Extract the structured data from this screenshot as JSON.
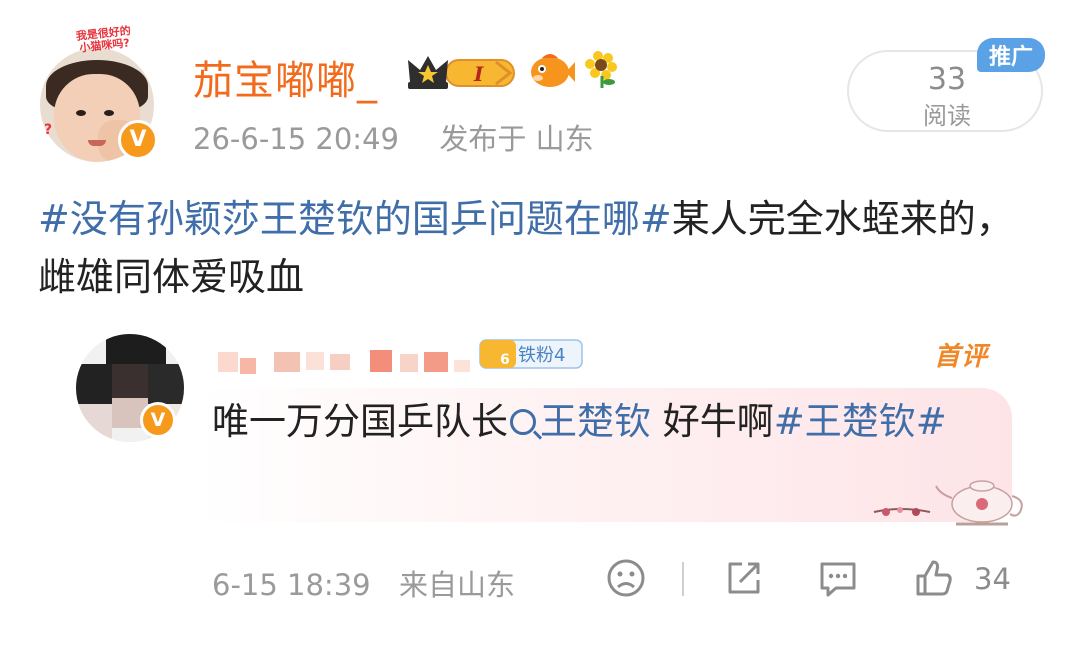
{
  "post": {
    "author": "茄宝嘟嘟_",
    "avatar_sticker_line1": "我是很好的",
    "avatar_sticker_line2": "小猫咪吗?",
    "avatar_sticker_mark": "?",
    "verified_mark": "V",
    "level_badge": "I",
    "time": "26-6-15 20:49",
    "location": "发布于 山东",
    "read_count": "33",
    "read_label": "阅读",
    "promo_tag": "推广",
    "text": {
      "tag1": "#没有孙颖莎王楚钦的国乒问题在哪#",
      "plain1": "某人完全水蛭来的，雌雄同体爱吸血"
    }
  },
  "comment": {
    "fan_badge": "铁粉4",
    "fan_level": "6",
    "first_label": "首评",
    "verified_mark": "V",
    "text": {
      "plain1": "唯一万分国乒队长",
      "mention": "王楚钦",
      "plain2": " 好牛啊",
      "tag": "#王楚钦#"
    },
    "time": "6-15 18:39",
    "location": "来自山东",
    "likes": "34"
  },
  "colors": {
    "author": "#f26b1c",
    "hashtag": "#3f6ea8",
    "meta": "#9a9a9a",
    "promo": "#5aa1e6",
    "first_comment": "#f0882a"
  },
  "icons": [
    "crown-level-icon",
    "fish-emoji-icon",
    "sunflower-icon",
    "search-icon",
    "sad-face-icon",
    "share-icon",
    "comment-icon",
    "thumbs-up-icon"
  ]
}
